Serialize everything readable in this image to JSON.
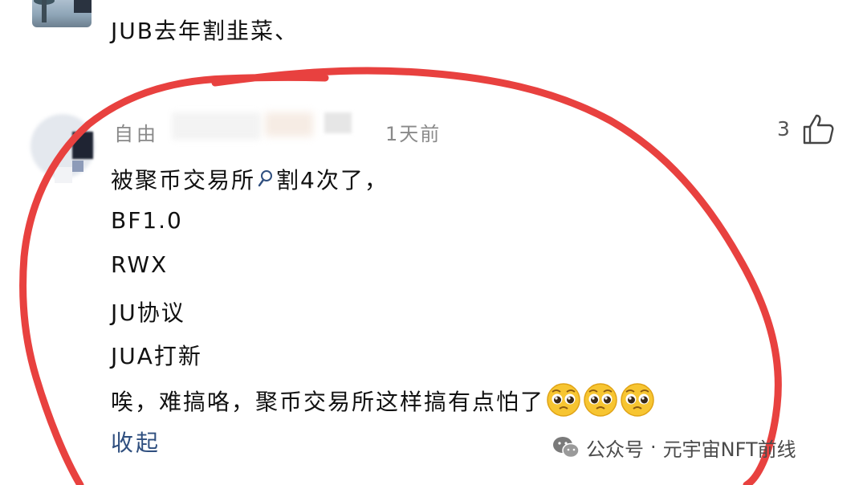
{
  "previous_comment": {
    "text": "JUB去年割韭菜、"
  },
  "comment": {
    "username": "自由",
    "time": "1天前",
    "likes": "3",
    "lines": [
      "被聚币交易所",
      "割4次了，",
      "BF1.0",
      "RWX",
      "JU协议",
      "JUA打新",
      "唉，难搞咯，聚币交易所这样搞有点怕了"
    ],
    "collapse_label": "收起",
    "icons": {
      "search": "search-icon",
      "like": "thumbs-up-icon",
      "emoji": "pleading-face-emoji"
    },
    "highlight_color": "#e8413f"
  },
  "watermark": {
    "prefix": "公众号",
    "separator": "·",
    "name": "元宇宙NFT前线"
  }
}
